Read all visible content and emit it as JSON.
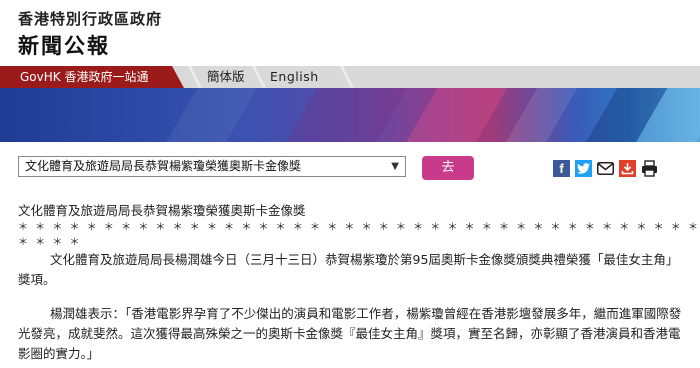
{
  "header": {
    "org_name": "香港特別行政區政府",
    "site_name": "新聞公報"
  },
  "nav": {
    "govhk": "GovHK 香港政府一站通",
    "simplified": "簡体版",
    "english": "English"
  },
  "toolbar": {
    "select_value": "文化體育及旅遊局局長恭賀楊紫瓊榮獲奧斯卡金像獎",
    "go_label": "去"
  },
  "article": {
    "title": "文化體育及旅遊局局長恭賀楊紫瓊榮獲奧斯卡金像獎",
    "separator": "＊ ＊ ＊ ＊ ＊ ＊ ＊ ＊ ＊ ＊ ＊ ＊ ＊ ＊ ＊ ＊ ＊ ＊ ＊ ＊ ＊ ＊ ＊ ＊ ＊ ＊ ＊ ＊ ＊ ＊ ＊ ＊ ＊ ＊ ＊ ＊ ＊ ＊ ＊ ＊ ＊ ＊ ＊ ＊",
    "paragraphs": [
      "文化體育及旅遊局局長楊潤雄今日（三月十三日）恭賀楊紫瓊於第95屆奧斯卡金像獎頒獎典禮榮獲「最佳女主角」獎項。",
      "楊潤雄表示：「香港電影界孕育了不少傑出的演員和電影工作者，楊紫瓊曾經在香港影壇發展多年，繼而進軍國際發光發亮，成就斐然。這次獲得最高殊榮之一的奧斯卡金像獎『最佳女主角』獎項，實至名歸，亦彰顯了香港演員和香港電影圈的實力。」"
    ]
  },
  "icons": {
    "facebook": "facebook-icon",
    "twitter": "twitter-icon",
    "email": "email-icon",
    "save": "save-icon",
    "print": "print-icon"
  },
  "colors": {
    "govhk_red": "#9b1b1b",
    "go_button": "#c83a8a",
    "navbar_grey": "#d9d9d9"
  }
}
